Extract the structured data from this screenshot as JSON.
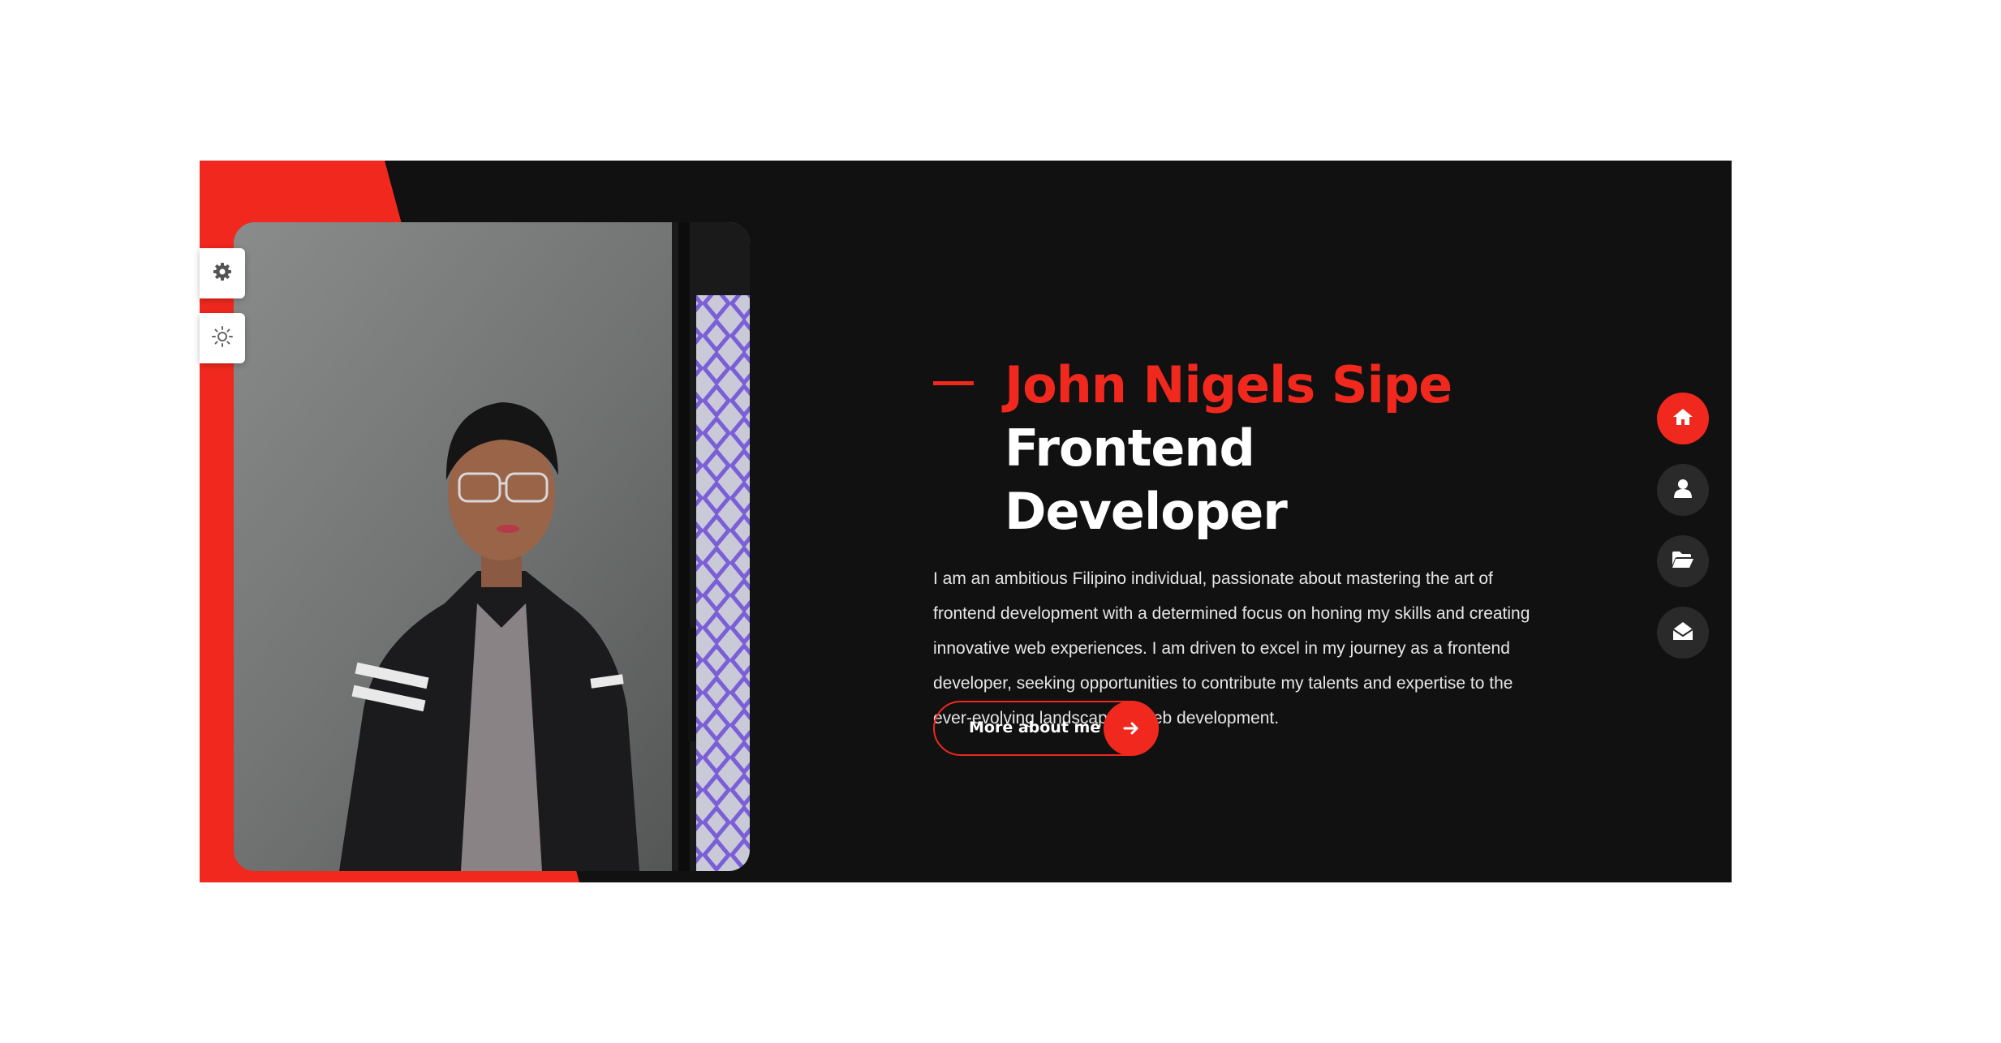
{
  "colors": {
    "accent": "#f0281d",
    "hero_background": "#111111",
    "page_background": "#ffffff",
    "nav_inactive": "#2a2a2a"
  },
  "settings_widgets": [
    {
      "icon": "gear-icon"
    },
    {
      "icon": "sun-icon"
    }
  ],
  "hero": {
    "name": "John Nigels Sipe",
    "role": "Frontend Developer",
    "bio": "I am an ambitious Filipino individual, passionate about mastering the art of frontend development with a determined focus on honing my skills and creating innovative web experiences. I am driven to excel in my journey as a frontend developer, seeking opportunities to contribute my talents and expertise to the ever-evolving landscape of web development.",
    "cta_label": "More about me",
    "cta_icon": "arrow-right-icon"
  },
  "nav": {
    "items": [
      {
        "icon": "home-icon",
        "active": true
      },
      {
        "icon": "user-icon",
        "active": false
      },
      {
        "icon": "folder-open-icon",
        "active": false
      },
      {
        "icon": "envelope-open-icon",
        "active": false
      }
    ]
  }
}
